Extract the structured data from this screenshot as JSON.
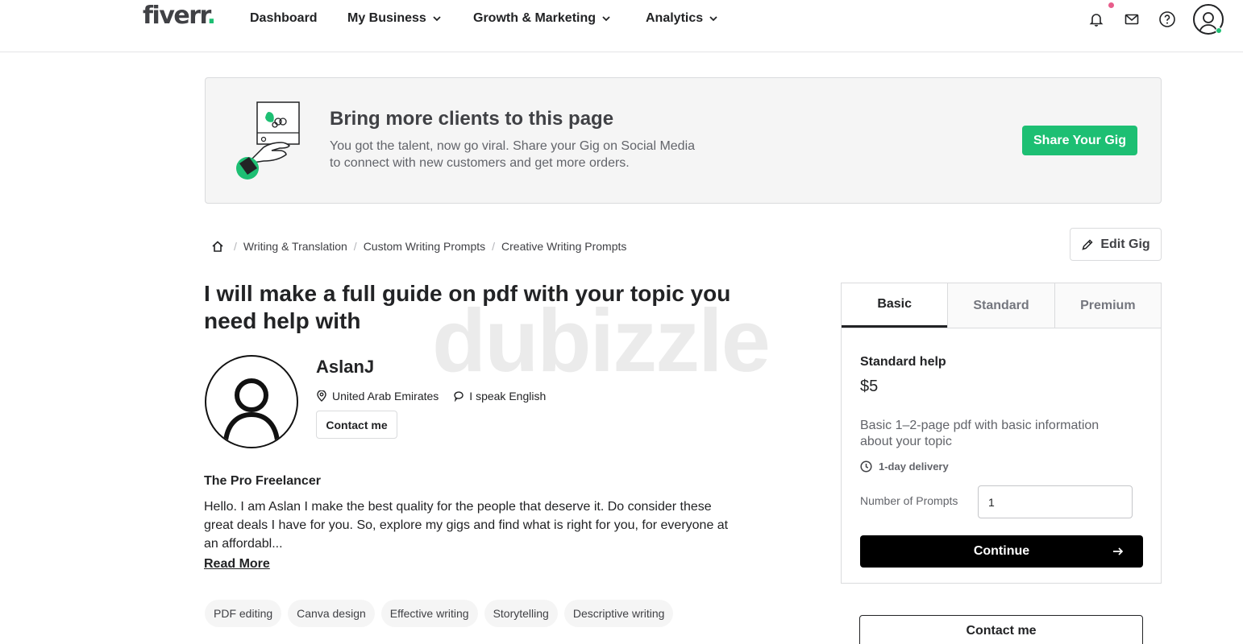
{
  "header": {
    "logo": "fiverr",
    "logo_dot": ".",
    "nav": [
      {
        "label": "Dashboard"
      },
      {
        "label": "My Business"
      },
      {
        "label": "Growth & Marketing"
      },
      {
        "label": "Analytics"
      }
    ],
    "icons": [
      "bell-icon",
      "mail-icon",
      "help-icon",
      "user-avatar-icon"
    ]
  },
  "promo": {
    "title": "Bring more clients to this page",
    "line1": "You got the talent, now go viral. Share your Gig on Social Media",
    "line2": "to connect with new customers and get more orders.",
    "button": "Share Your Gig"
  },
  "breadcrumb": {
    "items": [
      "Writing & Translation",
      "Custom Writing Prompts",
      "Creative Writing Prompts"
    ],
    "separator": "/"
  },
  "edit_gig": "Edit Gig",
  "gig": {
    "title_line1": "I will make a full guide on pdf with your topic you",
    "title_line2": "need help with"
  },
  "watermark": "dubizzle",
  "seller": {
    "name": "AslanJ",
    "country": "United Arab Emirates",
    "language": "I speak English",
    "contact": "Contact me",
    "about_title": "The Pro Freelancer",
    "about_line1": "Hello. I am Aslan I make the best quality for the people that deserve it. Do consider these",
    "about_line2": "great deals I have for you. So, explore my gigs and find what is right for you, for everyone at",
    "about_line3": "an affordabl...",
    "read_more": "Read More"
  },
  "tags": [
    "PDF editing",
    "Canva design",
    "Effective writing",
    "Storytelling",
    "Descriptive writing"
  ],
  "package": {
    "tabs": [
      "Basic",
      "Standard",
      "Premium"
    ],
    "name": "Standard help",
    "price": "$5",
    "desc_line1": "Basic 1–2-page pdf with basic information",
    "desc_line2": "about your topic",
    "delivery": "1-day delivery",
    "qty_label": "Number of Prompts",
    "qty_value": "1",
    "continue": "Continue"
  },
  "contact_lg": "Contact me",
  "colors": {
    "brand_green": "#1dbf73",
    "text": "#222325",
    "muted": "#62646a",
    "notif": "#e85d8b"
  }
}
